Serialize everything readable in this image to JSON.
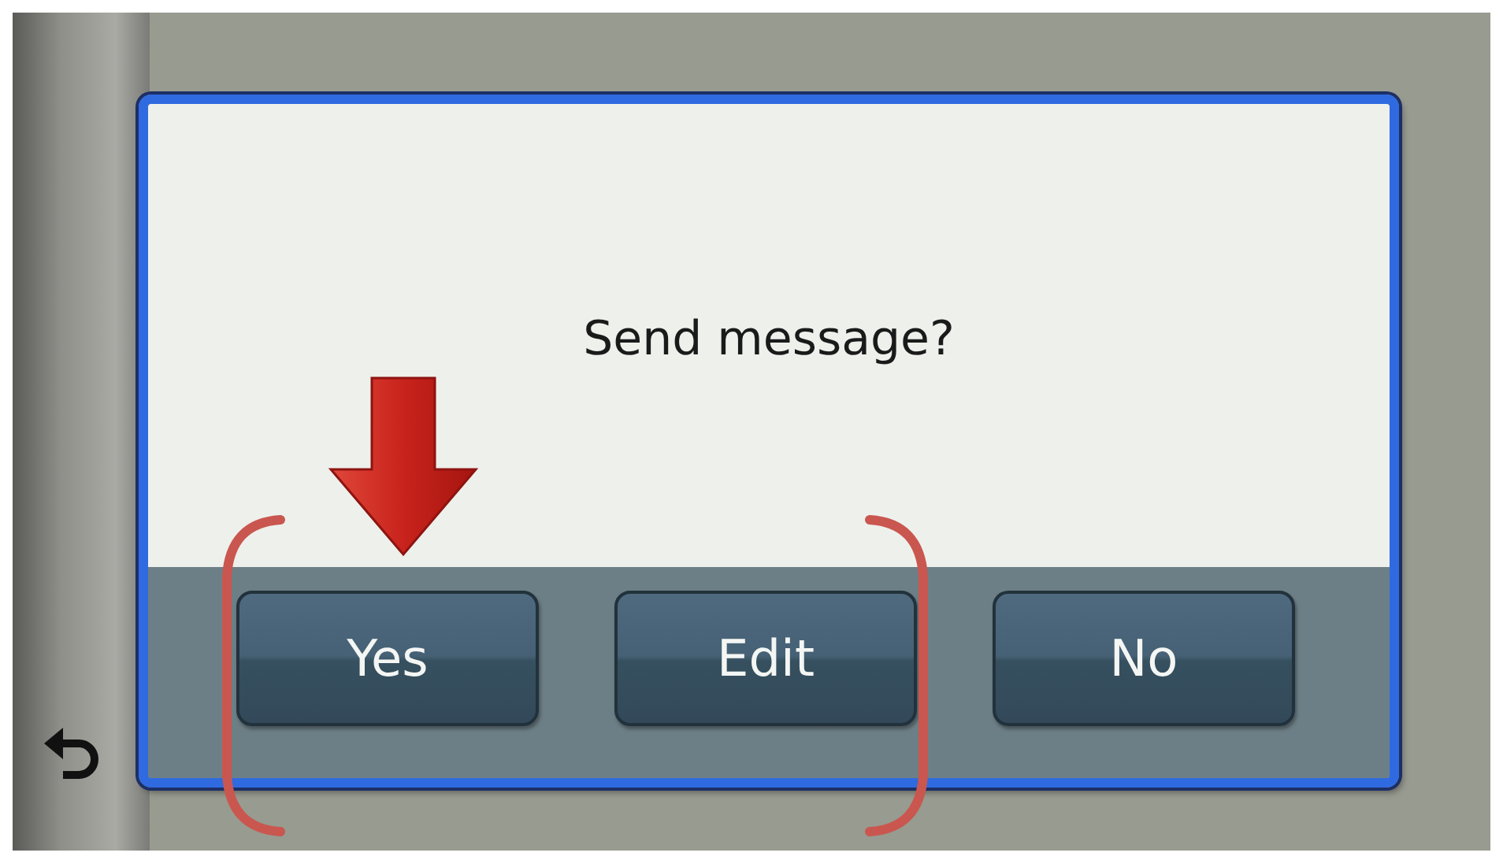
{
  "dialog": {
    "message": "Send message?",
    "buttons": [
      {
        "label": "Yes"
      },
      {
        "label": "Edit"
      },
      {
        "label": "No"
      }
    ]
  }
}
